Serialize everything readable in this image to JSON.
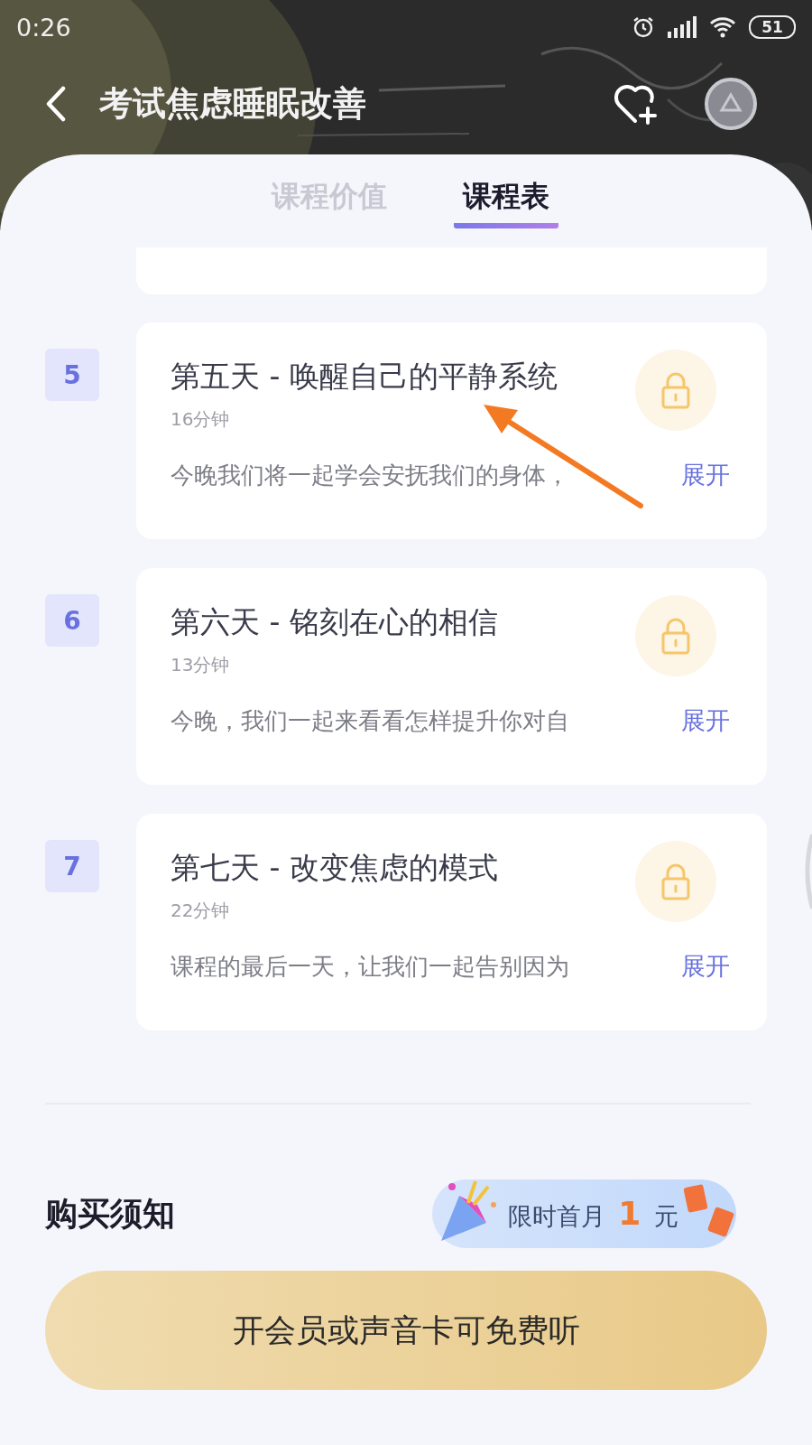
{
  "status_bar": {
    "time": "0:26",
    "battery": "51"
  },
  "header": {
    "title": "考试焦虑睡眠改善"
  },
  "tabs": [
    {
      "label": "课程价值",
      "selected": false
    },
    {
      "label": "课程表",
      "selected": true
    }
  ],
  "lessons": [
    {
      "number": "5",
      "title": "第五天 - 唤醒自己的平静系统",
      "duration": "16分钟",
      "summary": "今晚我们将一起学会安抚我们的身体，",
      "expand": "展开",
      "locked": true
    },
    {
      "number": "6",
      "title": "第六天 - 铭刻在心的相信",
      "duration": "13分钟",
      "summary": "今晚，我们一起来看看怎样提升你对自",
      "expand": "展开",
      "locked": true
    },
    {
      "number": "7",
      "title": "第七天 - 改变焦虑的模式",
      "duration": "22分钟",
      "summary": "课程的最后一天，让我们一起告别因为",
      "expand": "展开",
      "locked": true
    }
  ],
  "purchase_notice": {
    "heading": "购买须知",
    "promo": "限时首月 **1** 元"
  },
  "cta": "开会员或声音卡可免费听"
}
